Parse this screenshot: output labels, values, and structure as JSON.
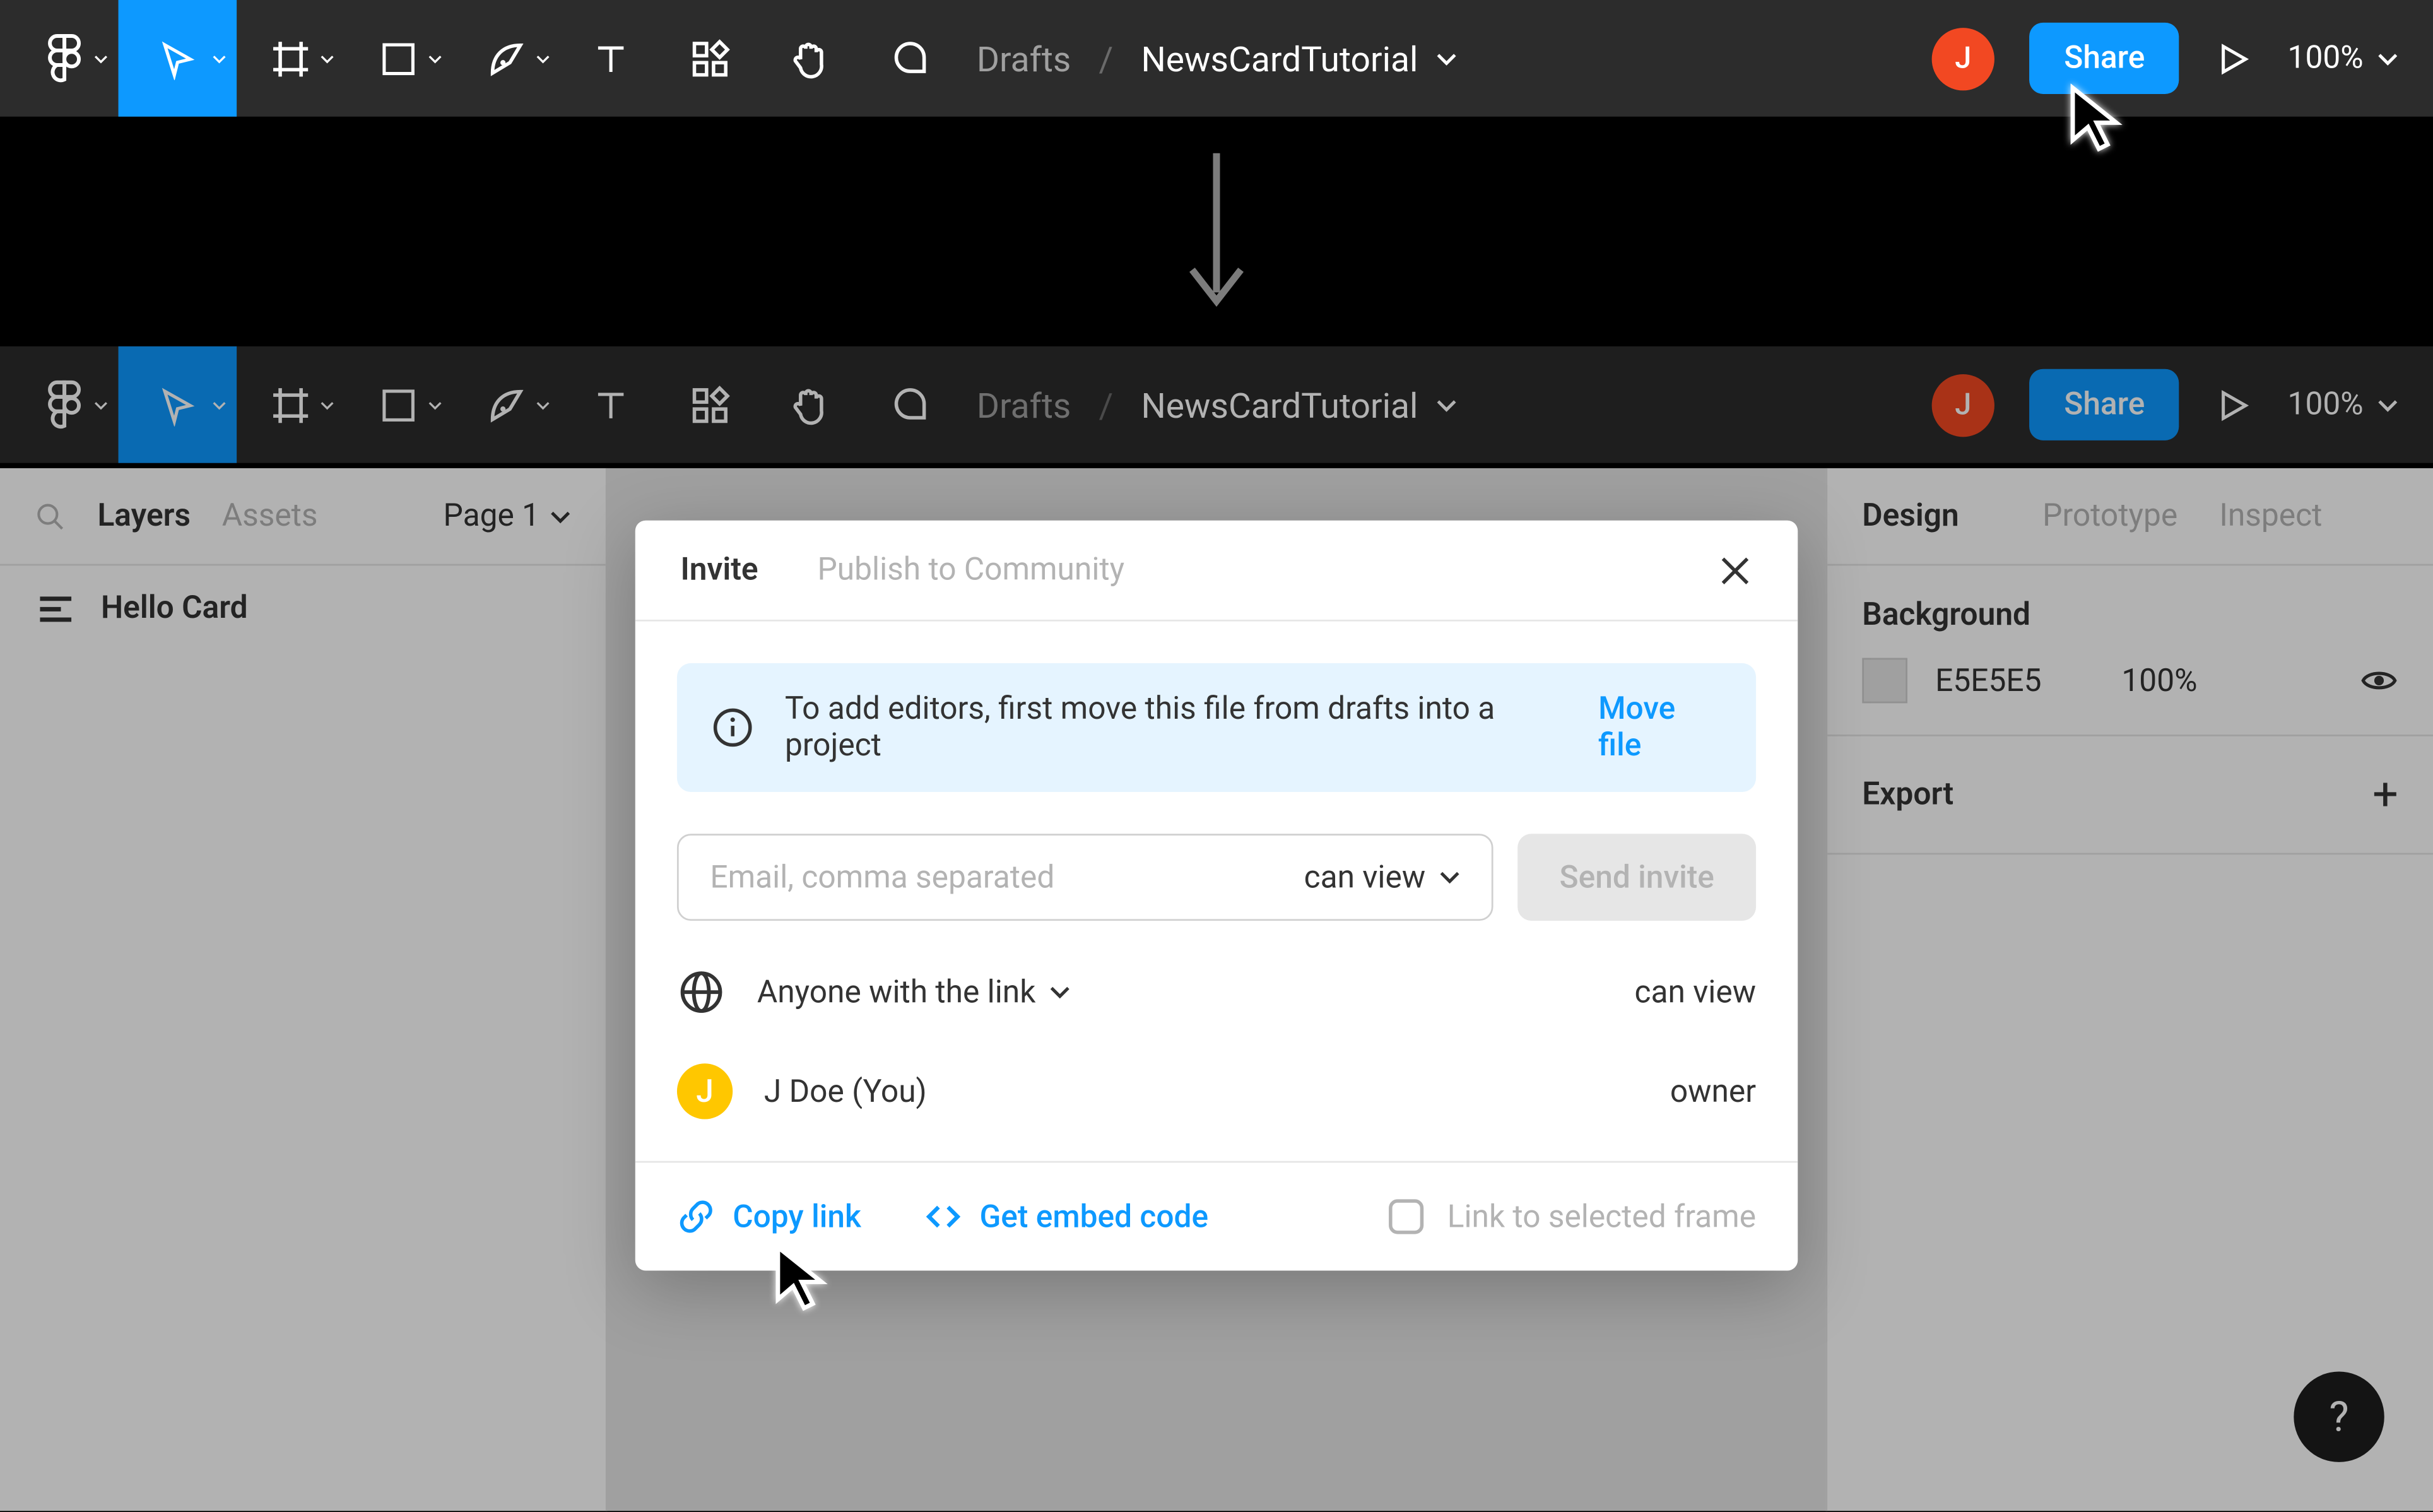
{
  "toolbar": {
    "drafts_label": "Drafts",
    "file_name": "NewsCardTutorial",
    "avatar_initial": "J",
    "share_label": "Share",
    "zoom_label": "100%"
  },
  "left_panel": {
    "tab_layers": "Layers",
    "tab_assets": "Assets",
    "page_label": "Page 1",
    "layer_name": "Hello Card"
  },
  "right_panel": {
    "tab_design": "Design",
    "tab_prototype": "Prototype",
    "tab_inspect": "Inspect",
    "background_title": "Background",
    "bg_hex": "E5E5E5",
    "bg_opacity": "100%",
    "export_title": "Export"
  },
  "dialog": {
    "tab_invite": "Invite",
    "tab_publish": "Publish to Community",
    "info_text": "To add editors, first move this file from drafts into a project",
    "move_file": "Move file",
    "email_placeholder": "Email, comma separated",
    "perm_can_view": "can view",
    "send_invite": "Send invite",
    "anyone_label": "Anyone with the link",
    "anyone_perm": "can view",
    "user_initial": "J",
    "user_name": "J Doe (You)",
    "user_perm": "owner",
    "copy_link": "Copy link",
    "embed_code": "Get embed code",
    "link_frame": "Link to selected frame"
  }
}
